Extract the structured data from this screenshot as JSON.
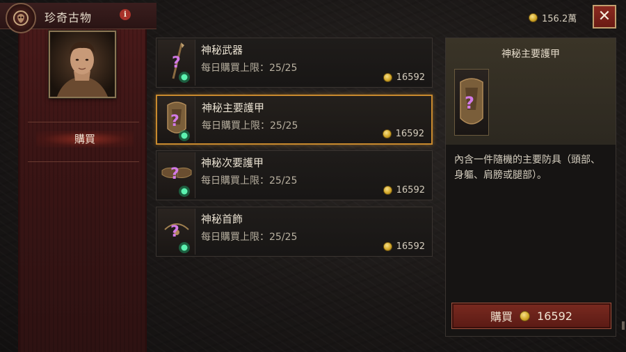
{
  "header": {
    "title": "珍奇古物",
    "info_icon": "i"
  },
  "sidebar": {
    "buy_tab_label": "購買"
  },
  "currency": {
    "total": "156.2萬"
  },
  "close_label": "✕",
  "items": [
    {
      "name": "神秘武器",
      "limit": "每日購買上限：25/25",
      "price": "16592",
      "icon": "weapon-icon"
    },
    {
      "name": "神秘主要護甲",
      "limit": "每日購買上限：25/25",
      "price": "16592",
      "icon": "armor-icon"
    },
    {
      "name": "神秘次要護甲",
      "limit": "每日購買上限：25/25",
      "price": "16592",
      "icon": "secondary-armor-icon"
    },
    {
      "name": "神秘首飾",
      "limit": "每日購買上限：25/25",
      "price": "16592",
      "icon": "jewelry-icon"
    }
  ],
  "detail": {
    "title": "神秘主要護甲",
    "description": "內含一件隨機的主要防具（頭部、身軀、肩膀或腿部）。",
    "buy_label": "購買",
    "buy_price": "16592"
  },
  "colors": {
    "accent": "#c98a2e",
    "button_red": "#7a2a20",
    "gem_green": "#3ee8a0",
    "question_purple": "#c66ad8"
  }
}
